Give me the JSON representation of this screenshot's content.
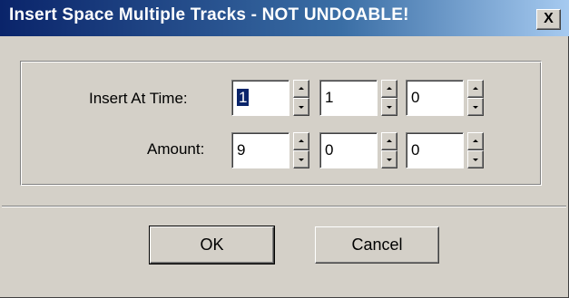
{
  "window": {
    "title": "Insert Space Multiple Tracks - NOT UNDOABLE!",
    "close_label": "X"
  },
  "form": {
    "insert_at_time": {
      "label": "Insert  At Time:",
      "values": [
        "1",
        "1",
        "0"
      ]
    },
    "amount": {
      "label": "Amount:",
      "values": [
        "9",
        "0",
        "0"
      ]
    }
  },
  "buttons": {
    "ok": "OK",
    "cancel": "Cancel"
  },
  "colors": {
    "titlebar_start": "#0a246a",
    "titlebar_end": "#a6caf0",
    "face": "#d4d0c8"
  }
}
